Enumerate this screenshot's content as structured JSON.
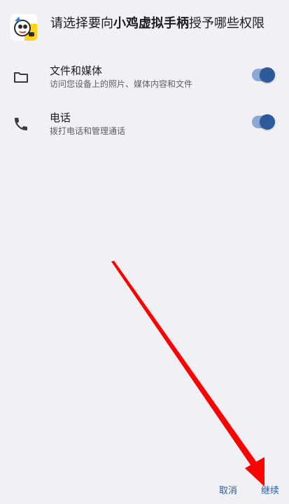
{
  "dialog": {
    "title_prefix": "请选择要向",
    "app_name": "小鸡虚拟手柄",
    "title_suffix": "授予哪些权限"
  },
  "permissions": [
    {
      "label": "文件和媒体",
      "description": "访问您设备上的照片、媒体内容和文件",
      "icon": "folder-icon",
      "enabled": true
    },
    {
      "label": "电话",
      "description": "拨打电话和管理通话",
      "icon": "phone-icon",
      "enabled": true
    }
  ],
  "footer": {
    "cancel_label": "取消",
    "continue_label": "继续"
  },
  "colors": {
    "background": "#f1f0f5",
    "accent": "#2e5a99",
    "arrow": "#ff0000"
  }
}
